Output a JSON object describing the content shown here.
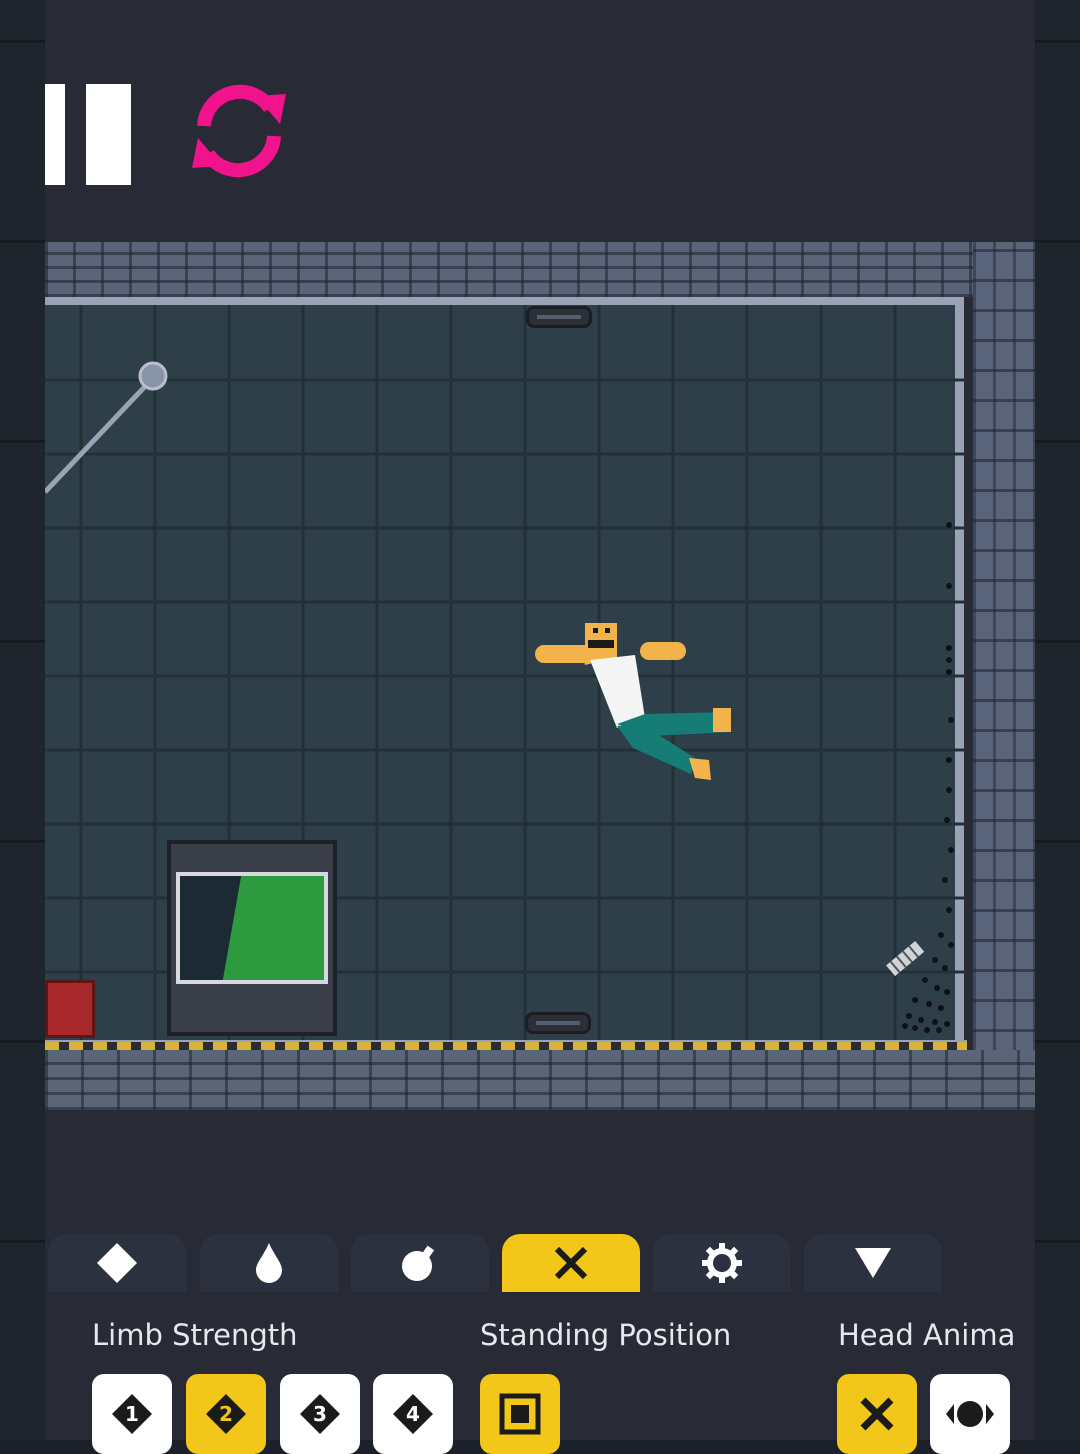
{
  "top_controls": {
    "pause_icon": "pause-icon",
    "reload_icon": "reload-icon",
    "reload_color": "#f0138b"
  },
  "toolbar": {
    "tabs": [
      {
        "icon": "diamond-icon",
        "active": false
      },
      {
        "icon": "droplet-icon",
        "active": false
      },
      {
        "icon": "bomb-icon",
        "active": false
      },
      {
        "icon": "x-icon",
        "active": true
      },
      {
        "icon": "gear-icon",
        "active": false
      },
      {
        "icon": "triangle-down-icon",
        "active": false
      }
    ],
    "accent": "#f2c719"
  },
  "settings": {
    "limb_strength": {
      "label": "Limb Strength",
      "options": [
        "1",
        "2",
        "3",
        "4"
      ],
      "selected": "2"
    },
    "standing_position": {
      "label": "Standing Position",
      "selected_icon": "square-icon"
    },
    "head_animation": {
      "label": "Head Anima",
      "options_icons": [
        "x-icon",
        "eye-icon"
      ],
      "selected_icon": "x-icon"
    }
  }
}
